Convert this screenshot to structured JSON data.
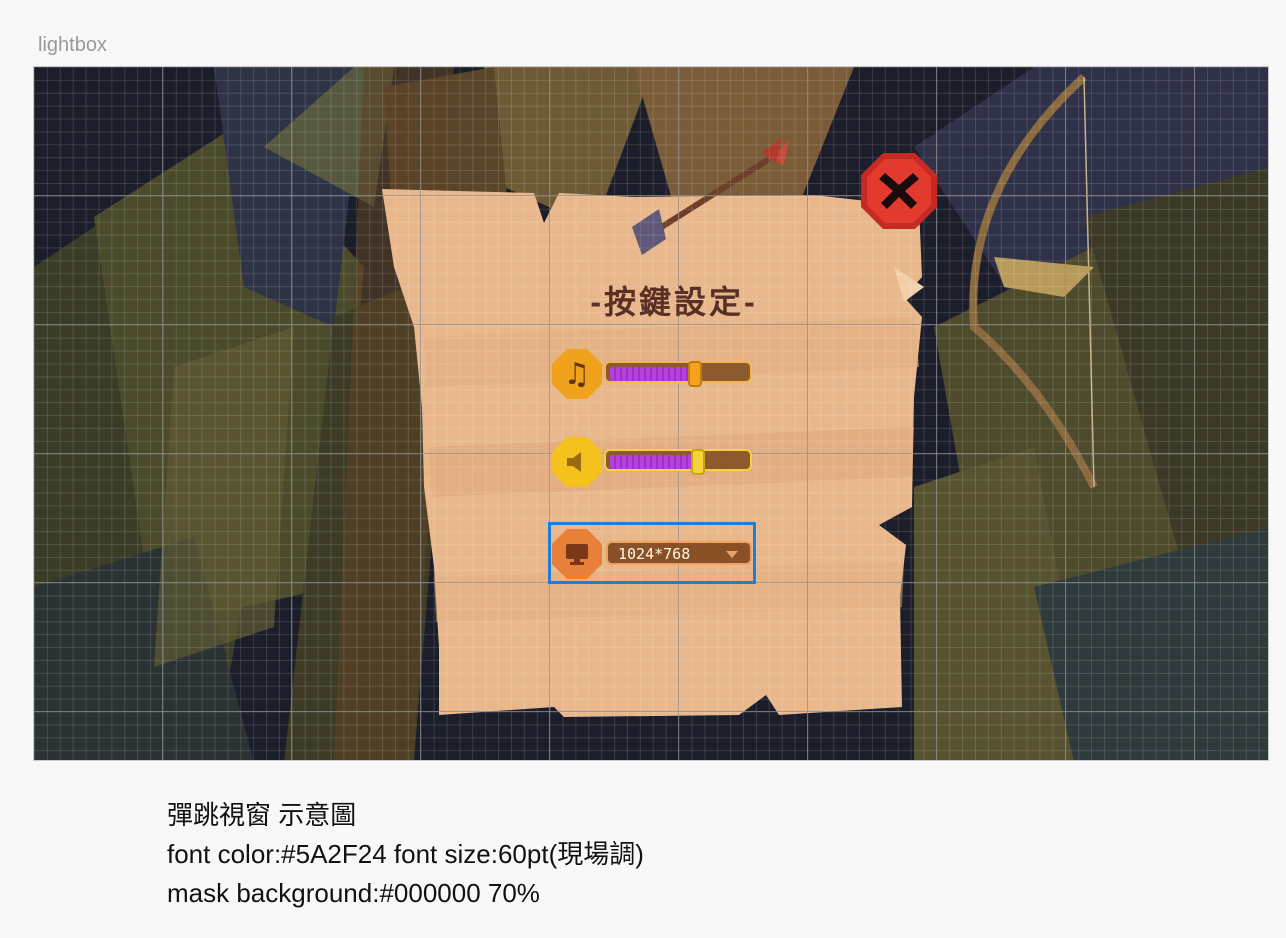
{
  "artboard": {
    "label": "lightbox"
  },
  "popup": {
    "title": "-按鍵設定-",
    "music": {
      "icon": "music-note-icon",
      "level": 0.62
    },
    "sound": {
      "icon": "speaker-icon",
      "level": 0.64
    },
    "resolution": {
      "icon": "monitor-icon",
      "value": "1024*768"
    },
    "close_icon": "close-x-icon"
  },
  "notes": {
    "line1": "彈跳視窗 示意圖",
    "line2": "font color:#5A2F24 font size:60pt(現場調)",
    "line3": "mask background:#000000 70%"
  },
  "colors": {
    "title": "#5A2F24",
    "mask": "#000000",
    "selection": "#1e7be0",
    "slider_fill": "#b442d8",
    "parchment": "#e8b88c"
  }
}
